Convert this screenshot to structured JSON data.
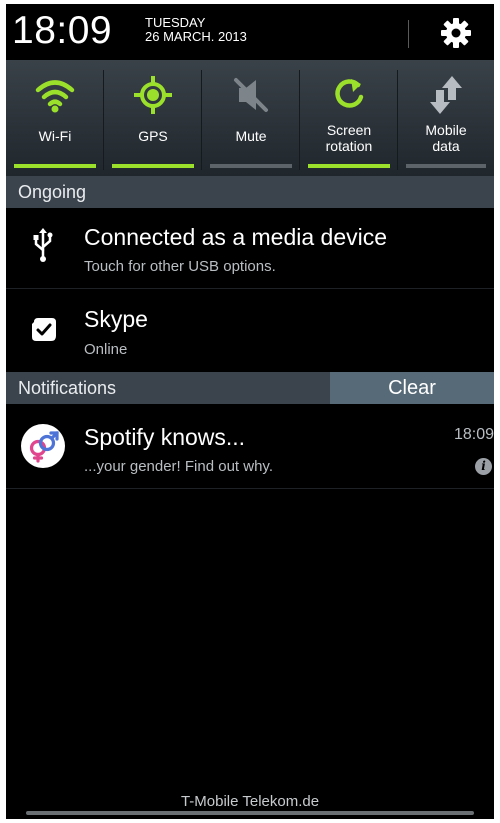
{
  "status": {
    "time": "18:09",
    "day": "TUESDAY",
    "date": "26 MARCH. 2013"
  },
  "quick_settings": [
    {
      "label": "Wi-Fi",
      "icon": "wifi-icon",
      "enabled": true
    },
    {
      "label": "GPS",
      "icon": "gps-icon",
      "enabled": true
    },
    {
      "label": "Mute",
      "icon": "mute-icon",
      "enabled": false
    },
    {
      "label": "Screen rotation",
      "icon": "screen-rotation-icon",
      "enabled": true
    },
    {
      "label": "Mobile data",
      "icon": "mobile-data-icon",
      "enabled": false
    }
  ],
  "ongoing": {
    "header": "Ongoing",
    "items": [
      {
        "title": "Connected as a media device",
        "subtitle": "Touch for other USB options.",
        "icon": "usb-icon"
      },
      {
        "title": "Skype",
        "subtitle": "Online",
        "icon": "skype-icon"
      }
    ]
  },
  "notifications": {
    "header": "Notifications",
    "clear_label": "Clear",
    "items": [
      {
        "title": "Spotify knows...",
        "subtitle": "...your gender! Find out why.",
        "time": "18:09",
        "icon": "gender-icon"
      }
    ]
  },
  "footer": {
    "carrier": "T-Mobile Telekom.de"
  },
  "colors": {
    "accent": "#9be02a",
    "panel": "#3b444c"
  }
}
